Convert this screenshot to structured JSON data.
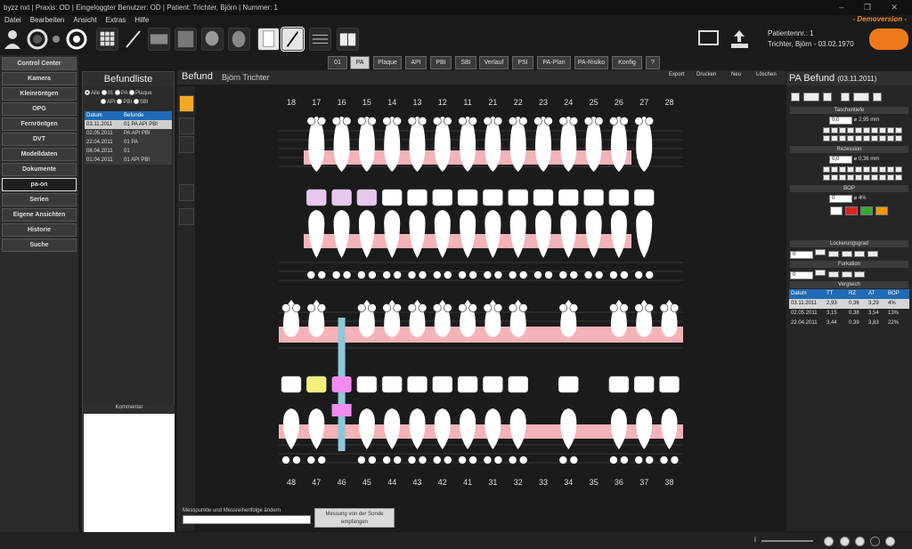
{
  "app": {
    "title": "byzz nxt | Praxis: OD | Eingeloggter Benutzer: OD | Patient: Trichter, Björn | Nummer: 1",
    "demo": "- Demoversion -"
  },
  "menu": [
    "Datei",
    "Bearbeiten",
    "Ansicht",
    "Extras",
    "Hilfe"
  ],
  "patient": {
    "number": "Patientennr.: 1",
    "name": "Trichter, Björn - 03.02.1970"
  },
  "nav": [
    "Control Center",
    "Kamera",
    "Kleinröntgen",
    "OPG",
    "Fernröntgen",
    "DVT",
    "Modelldaten",
    "Dokumente",
    "pa-on",
    "Serien",
    "Eigene Ansichten",
    "Historie",
    "Suche"
  ],
  "tabs": [
    "01",
    "PA",
    "Plaque",
    "API",
    "PBI",
    "SBI",
    "Verlauf",
    "PSI",
    "PA-Plan",
    "PA-Risiko",
    "Konfig",
    "?"
  ],
  "befundliste": {
    "title": "Befundliste",
    "filters": [
      "Alle",
      "01",
      "PA",
      "Plaque",
      "API",
      "PBI",
      "SBI"
    ],
    "col_date": "Datum",
    "col_befunde": "Befunde",
    "rows": [
      {
        "date": "03.11.2011",
        "befunde": "01 PA API PBI"
      },
      {
        "date": "02.05.2011",
        "befunde": "PA API PBI"
      },
      {
        "date": "22.04.2011",
        "befunde": "01 PA"
      },
      {
        "date": "08.04.2011",
        "befunde": "01"
      },
      {
        "date": "01.04.2011",
        "befunde": "01 API PBI"
      }
    ]
  },
  "kommentar": "Kommentar",
  "befund": {
    "title": "Befund",
    "patient": "Björn Trichter",
    "actions": [
      "Export",
      "Drucken",
      "Neu",
      "Löschen"
    ]
  },
  "upper_teeth": [
    "18",
    "17",
    "16",
    "15",
    "14",
    "13",
    "12",
    "11",
    "21",
    "22",
    "23",
    "24",
    "25",
    "26",
    "27",
    "28"
  ],
  "lower_teeth": [
    "48",
    "47",
    "46",
    "45",
    "44",
    "43",
    "42",
    "41",
    "31",
    "32",
    "33",
    "34",
    "35",
    "36",
    "37",
    "38"
  ],
  "messpunkte": {
    "label": "Messpunkte und Messreihenfolge ändern",
    "button": "Messung von der Sonde empfangen"
  },
  "pa": {
    "title": "PA Befund",
    "date": "(03.11.2011)",
    "taschentiefe": "Taschentiefe",
    "tt_value": "0,0",
    "tt_avg": "2,95 mm",
    "rezession": "Rezession",
    "rz_value": "0,0",
    "rz_avg": "0,36 mm",
    "bop": "BOP",
    "bop_value": "0",
    "bop_avg": "4%",
    "lockerung": "Lockerungsgrad",
    "lock_value": "0",
    "lock_opts": [
      "I",
      "II",
      "III",
      "IV"
    ],
    "furkation": "Furkation",
    "furk_value": "0",
    "furk_opts": [
      "1",
      "2",
      "3"
    ],
    "vergleich": "Vergleich",
    "cmp_cols": [
      "Datum",
      "TT",
      "RZ",
      "AT",
      "BOP"
    ],
    "cmp_rows": [
      [
        "03.11.2011",
        "2,93",
        "0,36",
        "3,29",
        "4%"
      ],
      [
        "02.05.2011",
        "3,15",
        "0,38",
        "3,54",
        "13%"
      ],
      [
        "22.04.2011",
        "3,44",
        "0,39",
        "3,83",
        "22%"
      ]
    ]
  },
  "status": {
    "zoom": "i"
  }
}
